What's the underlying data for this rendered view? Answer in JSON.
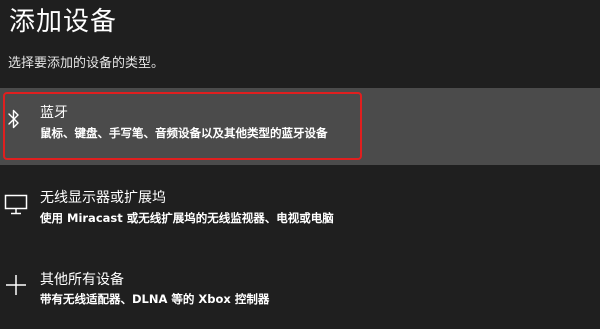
{
  "dialog": {
    "title": "添加设备",
    "subtitle": "选择要添加的设备的类型。"
  },
  "options": [
    {
      "icon": "bluetooth-icon",
      "label": "蓝牙",
      "description": "鼠标、键盘、手写笔、音频设备以及其他类型的蓝牙设备",
      "selected": true
    },
    {
      "icon": "monitor-icon",
      "label": "无线显示器或扩展坞",
      "description": "使用 Miracast 或无线扩展坞的无线监视器、电视或电脑",
      "selected": false
    },
    {
      "icon": "plus-icon",
      "label": "其他所有设备",
      "description": "带有无线适配器、DLNA 等的 Xbox 控制器",
      "selected": false
    }
  ],
  "colors": {
    "background": "#1f1f1f",
    "selected_background": "#4b4b4b",
    "highlight_border": "#e01f1f",
    "text": "#ffffff"
  }
}
